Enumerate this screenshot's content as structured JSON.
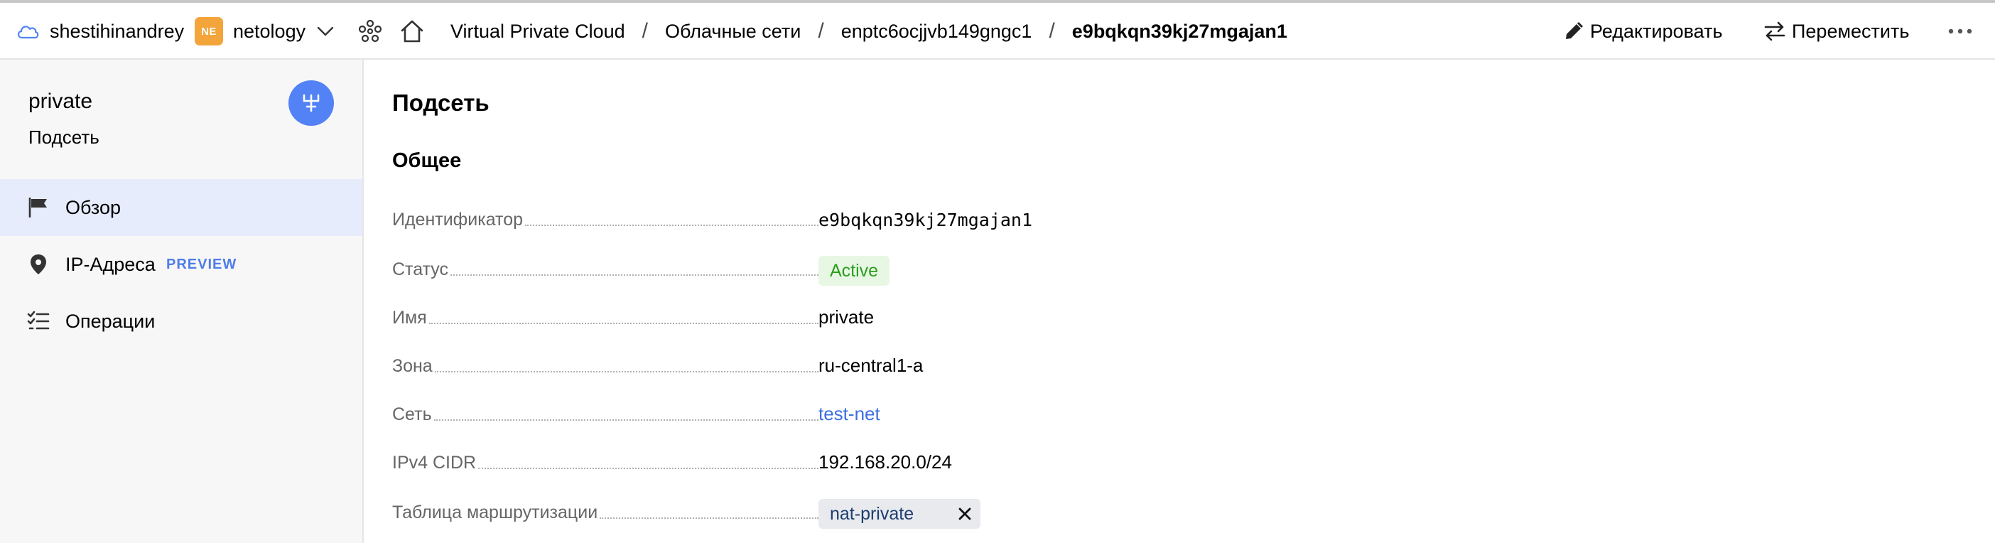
{
  "topbar": {
    "account": "shestihinandrey",
    "cloud_badge": "NE",
    "cloud": "netology",
    "breadcrumbs": [
      "Virtual Private Cloud",
      "Облачные сети",
      "enptc6ocjjvb149gngc1",
      "e9bqkqn39kj27mgajan1"
    ],
    "separator": "/",
    "edit_label": "Редактировать",
    "move_label": "Переместить"
  },
  "sidebar": {
    "title": "private",
    "subtitle": "Подсеть",
    "items": [
      {
        "label": "Обзор",
        "icon": "flag-icon",
        "active": true
      },
      {
        "label": "IP-Адреса",
        "icon": "location-pin-icon",
        "tag": "PREVIEW"
      },
      {
        "label": "Операции",
        "icon": "checklist-icon"
      }
    ]
  },
  "main": {
    "page_title": "Подсеть",
    "section_title": "Общее",
    "fields": {
      "id": {
        "label": "Идентификатор",
        "value": "e9bqkqn39kj27mgajan1"
      },
      "status": {
        "label": "Статус",
        "value": "Active"
      },
      "name": {
        "label": "Имя",
        "value": "private"
      },
      "zone": {
        "label": "Зона",
        "value": "ru-central1-a"
      },
      "network": {
        "label": "Сеть",
        "value": "test-net"
      },
      "cidr": {
        "label": "IPv4 CIDR",
        "value": "192.168.20.0/24"
      },
      "route_table": {
        "label": "Таблица маршрутизации",
        "value": "nat-private"
      }
    }
  },
  "colors": {
    "accent": "#5282f5",
    "link": "#3c6fe0",
    "status_bg": "#e8f7e4",
    "status_text": "#2c9e1f",
    "badge": "#f3a53b",
    "nav_active": "#e6ecfb"
  }
}
